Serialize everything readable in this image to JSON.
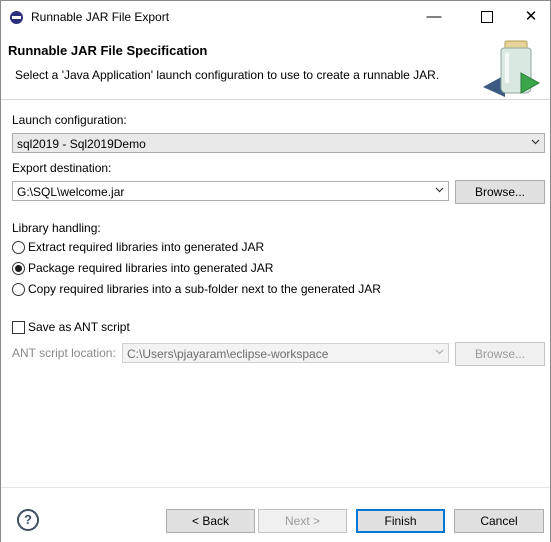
{
  "window": {
    "title": "Runnable JAR File Export",
    "minimize": "—",
    "close": "✕"
  },
  "header": {
    "title": "Runnable JAR File Specification",
    "description": "Select a 'Java Application' launch configuration to use to create a runnable JAR."
  },
  "form": {
    "launch_label": "Launch configuration:",
    "launch_value": "sql2019 - Sql2019Demo",
    "export_label": "Export destination:",
    "export_value": "G:\\SQL\\welcome.jar",
    "browse_label": "Browse...",
    "library_label": "Library handling:",
    "library_options": [
      {
        "label": "Extract required libraries into generated JAR",
        "checked": false
      },
      {
        "label": "Package required libraries into generated JAR",
        "checked": true
      },
      {
        "label": "Copy required libraries into a sub-folder next to the generated JAR",
        "checked": false
      }
    ],
    "ant_checkbox_label": "Save as ANT script",
    "ant_checked": false,
    "ant_location_label": "ANT script location:",
    "ant_location_value": "C:\\Users\\pjayaram\\eclipse-workspace",
    "ant_browse_label": "Browse..."
  },
  "footer": {
    "help_symbol": "?",
    "back_label": "< Back",
    "next_label": "Next >",
    "finish_label": "Finish",
    "cancel_label": "Cancel"
  },
  "colors": {
    "accent": "#0078d7",
    "banner_jar": "#d9e8e0",
    "banner_arrow": "#3aa54a"
  },
  "icons": {
    "app": "eclipse-icon",
    "banner": "jar-export-icon",
    "help": "help-icon"
  }
}
